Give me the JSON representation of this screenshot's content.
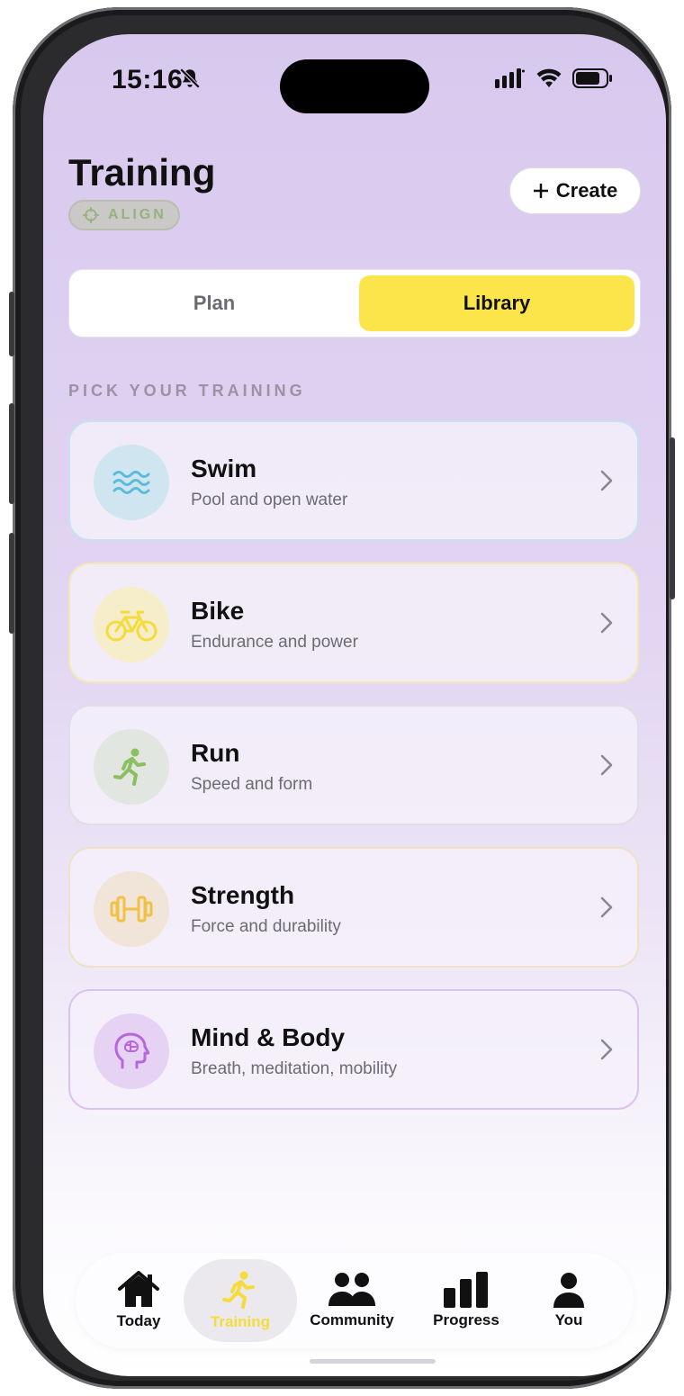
{
  "status_bar": {
    "time": "15:16"
  },
  "header": {
    "title": "Training",
    "badge": "ALIGN",
    "create_label": "Create"
  },
  "segmented": {
    "plan": "Plan",
    "library": "Library",
    "selected": "library"
  },
  "section_title": "PICK YOUR TRAINING",
  "trainings": [
    {
      "name": "Swim",
      "subtitle": "Pool and open water",
      "icon": "waves-icon",
      "accent": "#5bbcd9"
    },
    {
      "name": "Bike",
      "subtitle": "Endurance and power",
      "icon": "bicycle-icon",
      "accent": "#f5dc3c"
    },
    {
      "name": "Run",
      "subtitle": "Speed and form",
      "icon": "runner-icon",
      "accent": "#8cbf5f"
    },
    {
      "name": "Strength",
      "subtitle": "Force and durability",
      "icon": "dumbbell-icon",
      "accent": "#f1c045"
    },
    {
      "name": "Mind & Body",
      "subtitle": "Breath, meditation, mobility",
      "icon": "brain-head-icon",
      "accent": "#b866e0"
    }
  ],
  "tabs": [
    {
      "label": "Today",
      "icon": "home-icon"
    },
    {
      "label": "Training",
      "icon": "runner-icon",
      "selected": true
    },
    {
      "label": "Community",
      "icon": "people-icon"
    },
    {
      "label": "Progress",
      "icon": "bar-chart-icon"
    },
    {
      "label": "You",
      "icon": "person-icon"
    }
  ],
  "colors": {
    "accent_yellow": "#fce54b",
    "selected_tab_text": "#f5dc3c"
  }
}
